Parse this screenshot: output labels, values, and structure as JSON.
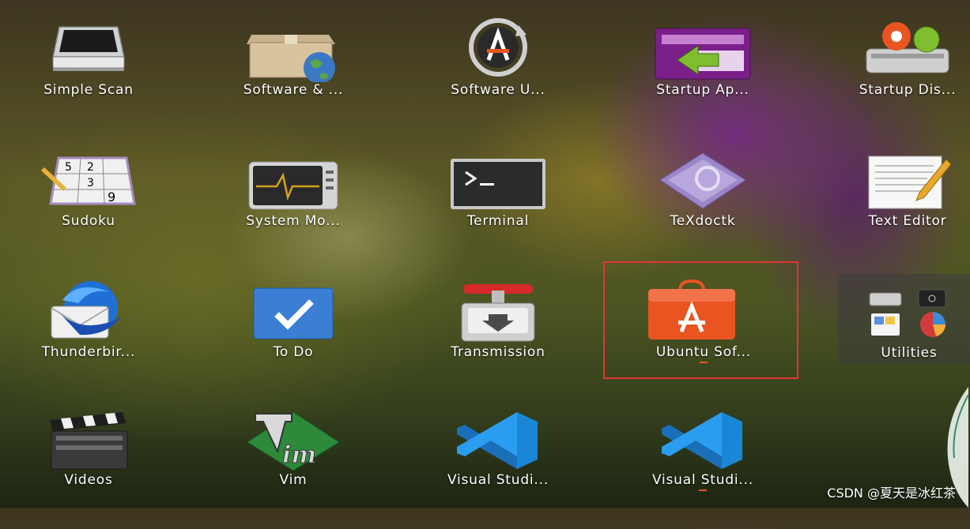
{
  "apps": [
    {
      "id": "simple-scan",
      "label": "Simple Scan"
    },
    {
      "id": "software-updates",
      "label": "Software & ..."
    },
    {
      "id": "software-updater",
      "label": "Software U..."
    },
    {
      "id": "startup-applications",
      "label": "Startup Ap..."
    },
    {
      "id": "startup-disk",
      "label": "Startup Dis..."
    },
    {
      "id": "sudoku",
      "label": "Sudoku"
    },
    {
      "id": "system-monitor",
      "label": "System Mo..."
    },
    {
      "id": "terminal",
      "label": "Terminal"
    },
    {
      "id": "texdoctk",
      "label": "TeXdoctk"
    },
    {
      "id": "text-editor",
      "label": "Text Editor"
    },
    {
      "id": "thunderbird",
      "label": "Thunderbir..."
    },
    {
      "id": "to-do",
      "label": "To Do"
    },
    {
      "id": "transmission",
      "label": "Transmission"
    },
    {
      "id": "ubuntu-software",
      "label": "Ubuntu Sof..."
    },
    {
      "id": "utilities",
      "label": "Utilities"
    },
    {
      "id": "videos",
      "label": "Videos"
    },
    {
      "id": "vim",
      "label": "Vim"
    },
    {
      "id": "visual-studio-code-1",
      "label": "Visual Studi..."
    },
    {
      "id": "visual-studio-code-2",
      "label": "Visual Studi..."
    }
  ],
  "sudoku_digits": [
    "5",
    "2",
    "3",
    "9"
  ],
  "watermark": "CSDN @夏天是冰红茶",
  "colors": {
    "accent": "#e95420",
    "highlight": "#e03535"
  }
}
